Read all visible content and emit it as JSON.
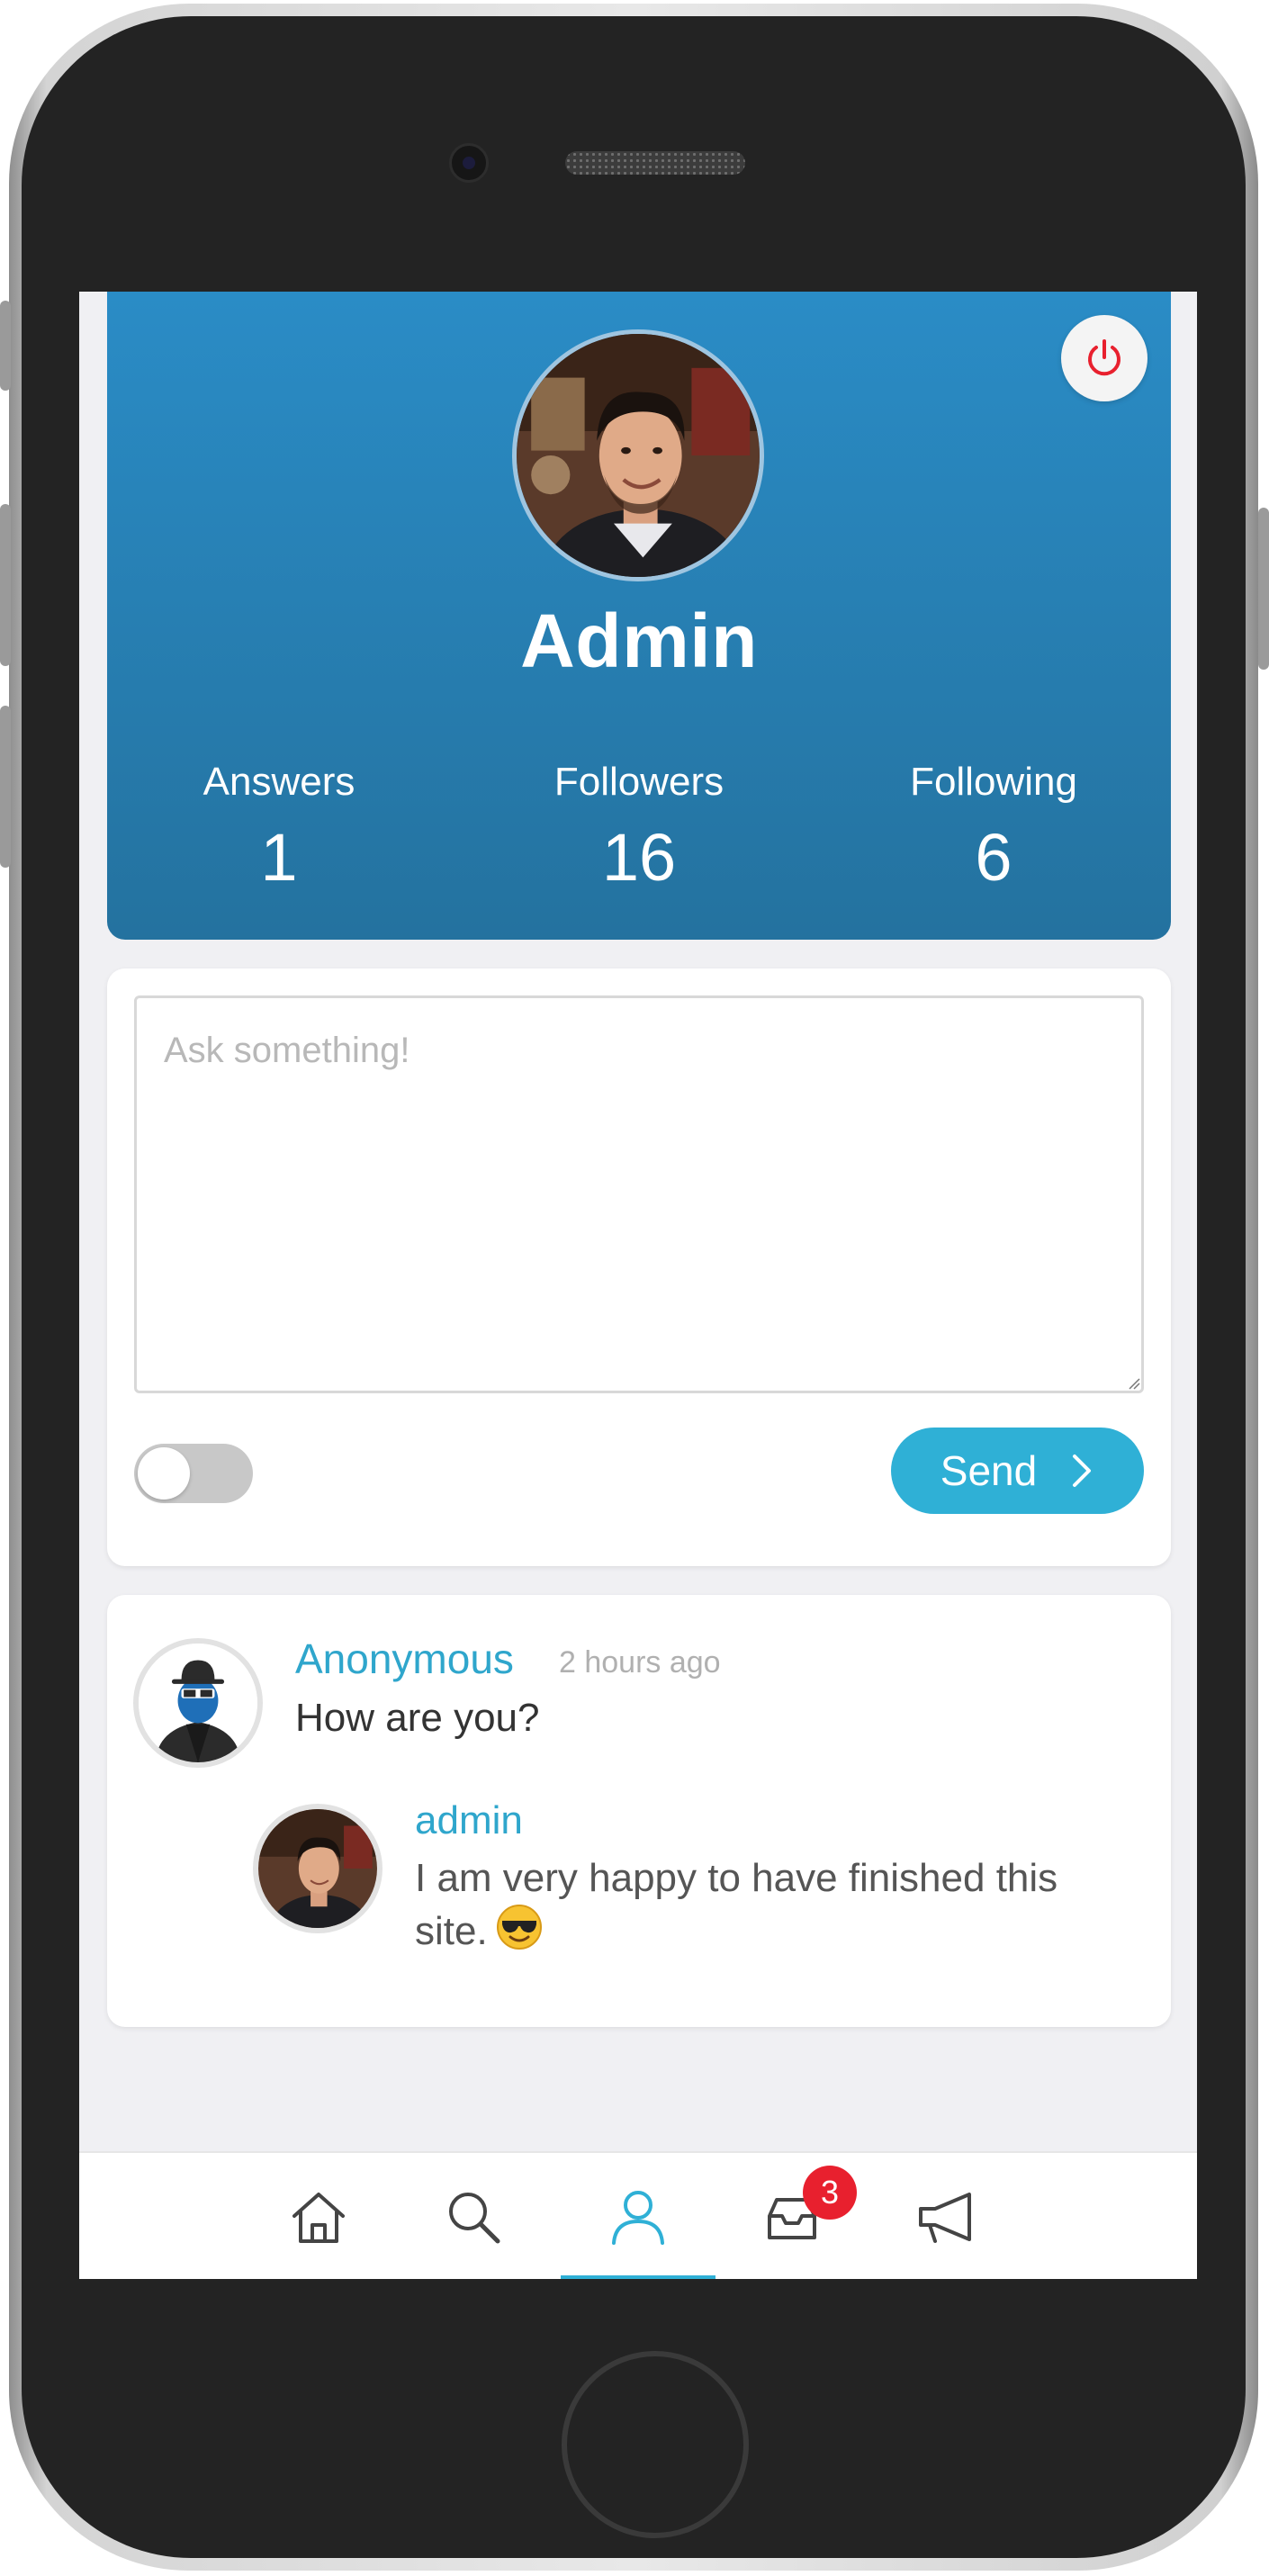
{
  "profile": {
    "name": "Admin",
    "stats": [
      {
        "label": "Answers",
        "value": "1"
      },
      {
        "label": "Followers",
        "value": "16"
      },
      {
        "label": "Following",
        "value": "6"
      }
    ]
  },
  "ask": {
    "placeholder": "Ask something!",
    "value": "",
    "anonymous_toggle_on": false,
    "send_label": "Send"
  },
  "qa": {
    "asker": "Anonymous",
    "time": "2 hours ago",
    "question": "How are you?",
    "answerer": "admin",
    "answer": "I am very happy to have finished this site."
  },
  "nav": {
    "items": [
      "home-icon",
      "search-icon",
      "profile-icon",
      "inbox-icon",
      "megaphone-icon"
    ],
    "active": "profile-icon",
    "inbox_badge": "3"
  },
  "colors": {
    "header_top": "#2a8cc6",
    "header_bottom": "#24729f",
    "accent": "#2fb0d6",
    "badge": "#e8202e",
    "power": "#e8202e"
  }
}
